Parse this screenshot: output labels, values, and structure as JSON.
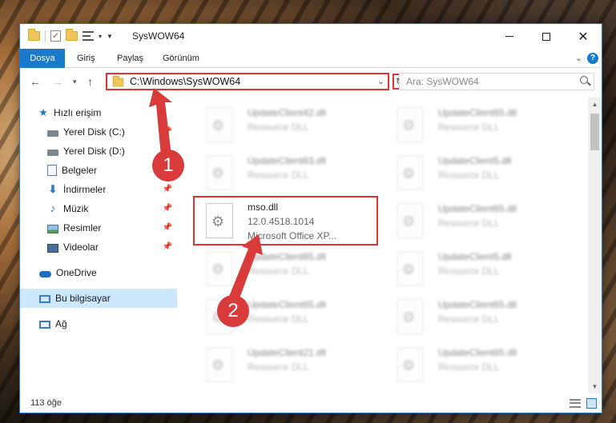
{
  "window": {
    "title": "SysWOW64",
    "accent": "#1979ca",
    "annotation_color": "#e03434"
  },
  "ribbon": {
    "tabs": [
      "Dosya",
      "Giriş",
      "Paylaş",
      "Görünüm"
    ],
    "help": "?"
  },
  "address": {
    "path": "C:\\Windows\\SysWOW64",
    "search_placeholder": "Ara: SysWOW64"
  },
  "nav_pane": {
    "items": [
      {
        "label": "Hızlı erişim",
        "icon": "star-icon"
      },
      {
        "label": "Yerel Disk (C:)",
        "icon": "disk-icon"
      },
      {
        "label": "Yerel Disk (D:)",
        "icon": "disk-icon"
      },
      {
        "label": "Belgeler",
        "icon": "document-icon"
      },
      {
        "label": "İndirmeler",
        "icon": "download-icon"
      },
      {
        "label": "Müzik",
        "icon": "music-icon"
      },
      {
        "label": "Resimler",
        "icon": "pictures-icon"
      },
      {
        "label": "Videolar",
        "icon": "video-icon"
      },
      {
        "label": "OneDrive",
        "icon": "cloud-icon"
      },
      {
        "label": "Bu bilgisayar",
        "icon": "computer-icon"
      },
      {
        "label": "Ağ",
        "icon": "network-icon"
      }
    ]
  },
  "files": {
    "left_column": [
      {
        "name": "UpdateClient42.dll",
        "desc": "Resource DLL"
      },
      {
        "name": "UpdateClient63.dll",
        "desc": "Resource DLL"
      },
      {
        "name": "mso.dll",
        "version": "12.0.4518.1014",
        "desc": "Microsoft Office XP..."
      },
      {
        "name": "UpdateClient65.dll",
        "desc": "Resource DLL"
      },
      {
        "name": "UpdateClient65.dll",
        "desc": "Resource DLL"
      },
      {
        "name": "UpdateClient21.dll",
        "desc": "Resource DLL"
      }
    ],
    "right_column": [
      {
        "name": "UpdateClient65.dll",
        "desc": "Resource DLL"
      },
      {
        "name": "UpdateClient5.dll",
        "desc": "Resource DLL"
      },
      {
        "name": "UpdateClient65.dll",
        "desc": "Resource DLL"
      },
      {
        "name": "UpdateClient5.dll",
        "desc": "Resource DLL"
      },
      {
        "name": "UpdateClient65.dll",
        "desc": "Resource DLL"
      },
      {
        "name": "UpdateClient65.dll",
        "desc": "Resource DLL"
      }
    ]
  },
  "status": {
    "item_count": "113 öğe"
  },
  "annotations": {
    "badge1": "1",
    "badge2": "2"
  }
}
